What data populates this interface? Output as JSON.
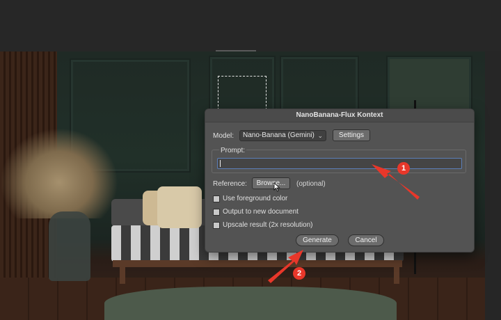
{
  "dialog": {
    "title": "NanoBanana-Flux Kontext",
    "model_label": "Model:",
    "model_value": "Nano-Banana (Gemini)",
    "settings_label": "Settings",
    "prompt_label": "Prompt:",
    "prompt_value": "",
    "reference_label": "Reference:",
    "browse_label": "Browse...",
    "optional_text": "(optional)",
    "checkboxes": [
      {
        "label": "Use foreground color",
        "checked": false
      },
      {
        "label": "Output to new document",
        "checked": false
      },
      {
        "label": "Upscale result (2x resolution)",
        "checked": false
      }
    ],
    "generate_label": "Generate",
    "cancel_label": "Cancel"
  },
  "annotations": {
    "step_1": "1",
    "step_2": "2",
    "color": "#e8372a"
  },
  "icons": {
    "chevron": "chevron-down-icon",
    "cursor": "mouse-pointer-icon"
  }
}
